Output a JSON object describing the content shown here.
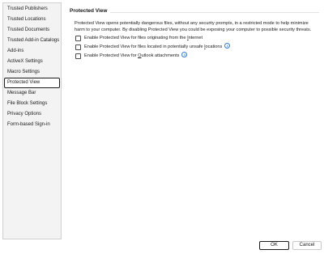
{
  "sidebar": {
    "items": [
      {
        "label": "Trusted Publishers",
        "selected": false
      },
      {
        "label": "Trusted Locations",
        "selected": false
      },
      {
        "label": "Trusted Documents",
        "selected": false
      },
      {
        "label": "Trusted Add-in Catalogs",
        "selected": false
      },
      {
        "label": "Add-ins",
        "selected": false
      },
      {
        "label": "ActiveX Settings",
        "selected": false
      },
      {
        "label": "Macro Settings",
        "selected": false
      },
      {
        "label": "Protected View",
        "selected": true
      },
      {
        "label": "Message Bar",
        "selected": false
      },
      {
        "label": "File Block Settings",
        "selected": false
      },
      {
        "label": "Privacy Options",
        "selected": false
      },
      {
        "label": "Form-based Sign-in",
        "selected": false
      }
    ]
  },
  "main": {
    "title": "Protected View",
    "description": "Protected View opens potentially dangerous files, without any security prompts, in a restricted mode to help minimize harm to your computer. By disabling Protected View you could be exposing your computer to possible security threats.",
    "options": [
      {
        "pre": "Enable Protected View for files originating from the ",
        "u": "I",
        "post": "nternet",
        "checked": false,
        "info": false
      },
      {
        "pre": "Enable Protected View for files located in potentially unsafe ",
        "u": "l",
        "post": "ocations",
        "checked": false,
        "info": true
      },
      {
        "pre": "Enable Protected View for ",
        "u": "O",
        "post": "utlook attachments",
        "checked": false,
        "info": true
      }
    ]
  },
  "footer": {
    "ok_label": "OK",
    "cancel_label": "Cancel"
  },
  "colors": {
    "info_icon": "#2f7bd8",
    "sidebar_bg": "#f3f3f3"
  }
}
